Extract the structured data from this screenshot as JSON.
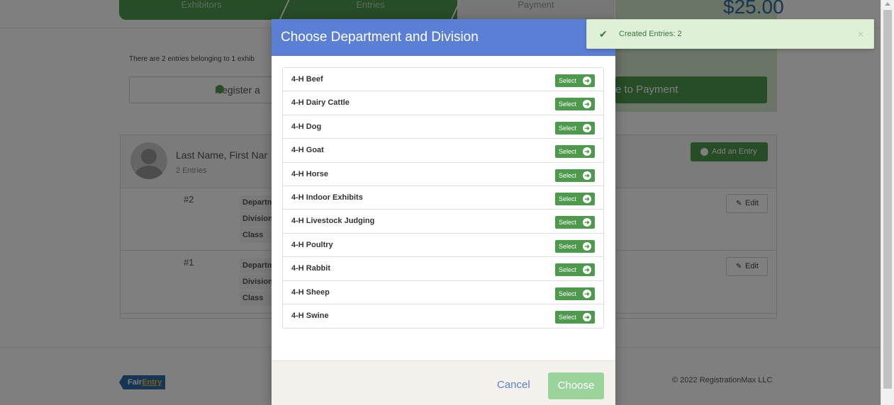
{
  "steps": [
    "Exhibitors",
    "Entries",
    "Payment"
  ],
  "total": "$25.00",
  "info_text": "There are 2 entries belonging to 1 exhib",
  "register_label": "Register a",
  "continue_label": "e to Payment",
  "exhibitor": {
    "name": "Last Name, First Nar",
    "count": "2 Entries",
    "add_entry_label": "Add an Entry",
    "entries": [
      {
        "num": "#2",
        "labels": [
          "Departm",
          "Division",
          "Class"
        ],
        "edit": "Edit"
      },
      {
        "num": "#1",
        "labels": [
          "Departm",
          "Division",
          "Class"
        ],
        "edit": "Edit"
      }
    ]
  },
  "footer": {
    "logo_fair": "Fair",
    "logo_entry": "Entry",
    "copyright": "© 2022 RegistrationMax LLC"
  },
  "modal": {
    "title": "Choose Department and Division",
    "select_label": "Select",
    "items": [
      "4-H Beef",
      "4-H Dairy Cattle",
      "4-H Dog",
      "4-H Goat",
      "4-H Horse",
      "4-H Indoor Exhibits",
      "4-H Livestock Judging",
      "4-H Poultry",
      "4-H Rabbit",
      "4-H Sheep",
      "4-H Swine"
    ],
    "cancel_label": "Cancel",
    "choose_label": "Choose"
  },
  "toast": {
    "message": "Created Entries: 2",
    "close": "×"
  },
  "colors": {
    "accent_blue": "#5b7fd4",
    "green": "#4d9a4d",
    "toast_bg": "#dff0d8"
  }
}
